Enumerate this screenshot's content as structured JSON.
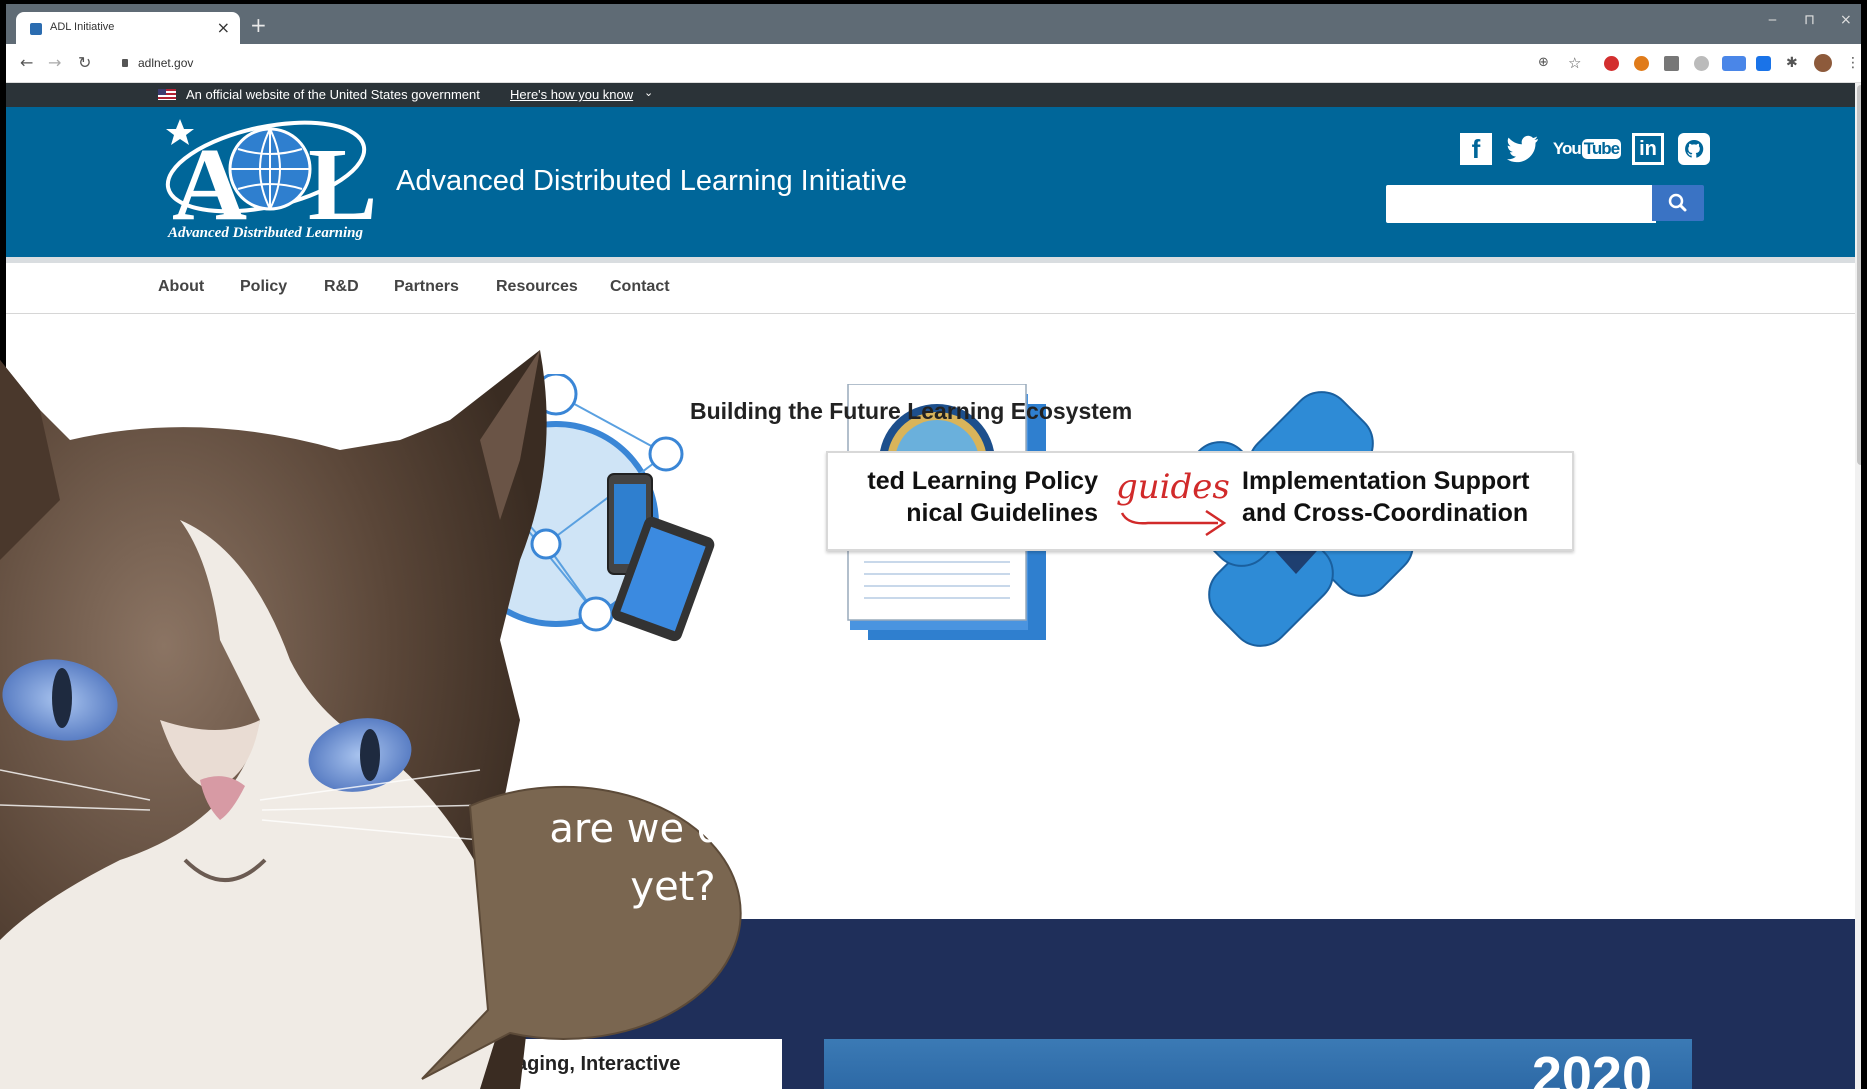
{
  "browser": {
    "tab_title": "ADL Initiative",
    "tab_close": "×",
    "new_tab": "+",
    "url": "adlnet.gov",
    "win_min": "‒",
    "win_max": "⊓",
    "win_close": "×"
  },
  "gov_banner": {
    "text": "An official website of the United States government",
    "link": "Here's how you know",
    "chevron": "⌄"
  },
  "header": {
    "logo_text": "ADL",
    "logo_subtitle": "Advanced Distributed Learning",
    "title": "Advanced Distributed Learning Initiative",
    "social": [
      "f",
      "t",
      "YouTube",
      "in",
      "gh"
    ]
  },
  "nav": {
    "items": [
      "About",
      "Policy",
      "R&D",
      "Partners",
      "Resources",
      "Contact"
    ]
  },
  "hero": {
    "tagline": "Building the Future Learning Ecosystem",
    "policy_left_line1": "ted Learning Policy",
    "policy_left_line2": "nical Guidelines",
    "policy_guides": "guides",
    "policy_right_line1": "Implementation Support",
    "policy_right_line2": "and Cross-Coordination"
  },
  "band": {
    "card_text": "aging, Interactive",
    "promo_year": "2020"
  },
  "overlay": {
    "speech_line1": "are we done",
    "speech_line2": "yet?"
  },
  "colors": {
    "header_blue": "#006699",
    "banner_dark": "#2b3338",
    "band_navy": "#1f2f5a",
    "search_button": "#3a73c4",
    "guides_red": "#d12a2a",
    "bubble_brown": "#7a6650"
  }
}
